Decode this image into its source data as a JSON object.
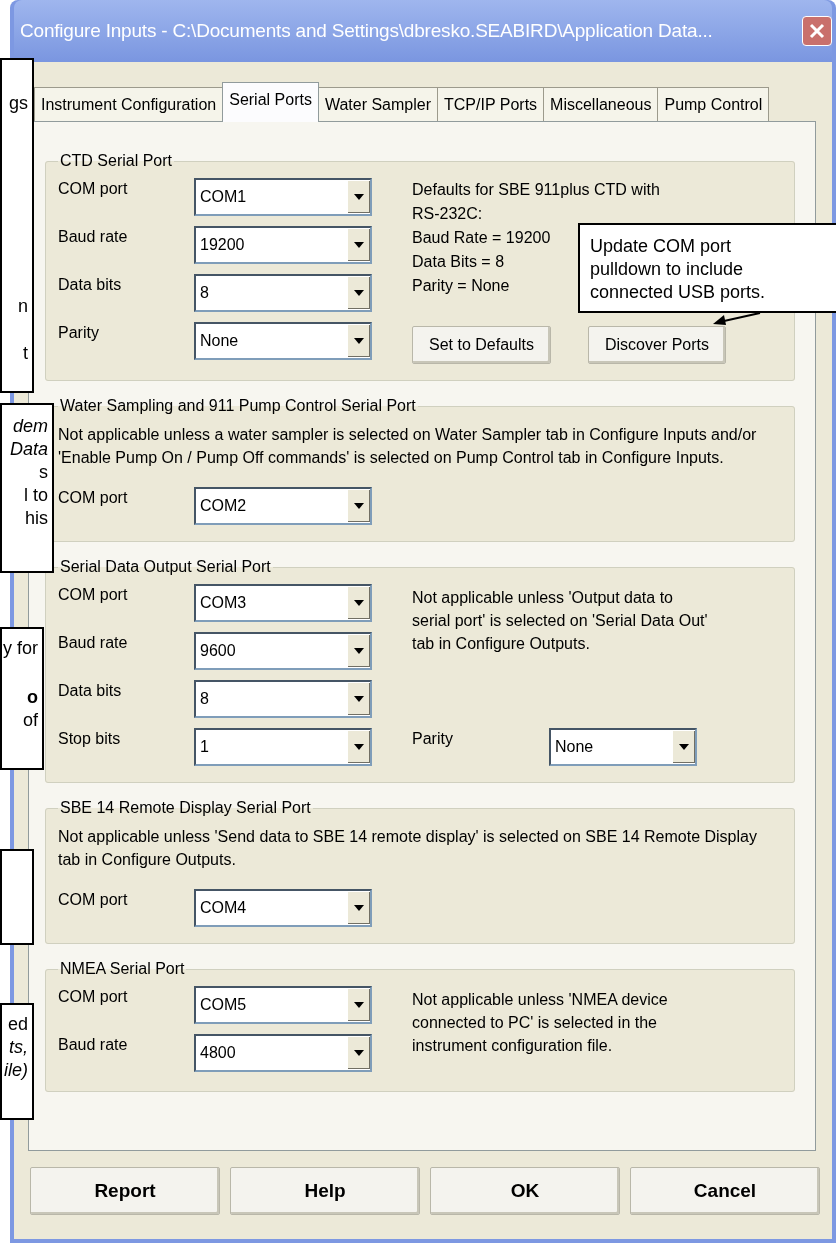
{
  "window": {
    "title": "Configure Inputs - C:\\Documents and Settings\\dbresko.SEABIRD\\Application Data..."
  },
  "tabs": [
    {
      "label": "Instrument Configuration",
      "selected": false
    },
    {
      "label": "Serial Ports",
      "selected": true
    },
    {
      "label": "Water Sampler",
      "selected": false
    },
    {
      "label": "TCP/IP Ports",
      "selected": false
    },
    {
      "label": "Miscellaneous",
      "selected": false
    },
    {
      "label": "Pump Control",
      "selected": false
    }
  ],
  "groups": [
    {
      "kind": "side",
      "title": "CTD Serial Port",
      "fields": [
        {
          "label": "COM port",
          "value": "COM1"
        },
        {
          "label": "Baud rate",
          "value": "19200"
        },
        {
          "label": "Data bits",
          "value": "8"
        },
        {
          "label": "Parity",
          "value": "None"
        }
      ],
      "defaults": [
        "Defaults for SBE 911plus CTD with",
        "RS-232C:",
        "Baud Rate = 19200",
        "Data Bits = 8",
        "Parity = None"
      ],
      "buttons": [
        "Set to Defaults",
        "Discover Ports"
      ]
    },
    {
      "kind": "above",
      "title": "Water Sampling and 911 Pump Control Serial Port",
      "note": "Not applicable unless a water sampler is selected on Water Sampler tab in Configure Inputs and/or 'Enable Pump On / Pump Off commands' is selected on Pump Control tab in Configure Inputs.",
      "fields": [
        {
          "label": "COM port",
          "value": "COM2"
        }
      ]
    },
    {
      "kind": "side",
      "title": "Serial Data Output Serial Port",
      "fields": [
        {
          "label": "COM port",
          "value": "COM3"
        },
        {
          "label": "Baud rate",
          "value": "9600"
        },
        {
          "label": "Data bits",
          "value": "8"
        },
        {
          "label": "Stop bits",
          "value": "1"
        }
      ],
      "note": "Not applicable unless 'Output data to serial port' is selected on 'Serial Data Out' tab in Configure Outputs.",
      "extra_field": {
        "label": "Parity",
        "value": "None"
      }
    },
    {
      "kind": "above",
      "title": "SBE 14 Remote Display Serial Port",
      "note": "Not applicable unless 'Send data to SBE 14 remote display' is selected on SBE 14 Remote Display tab in Configure Outputs.",
      "fields": [
        {
          "label": "COM port",
          "value": "COM4"
        }
      ]
    },
    {
      "kind": "side",
      "title": "NMEA Serial Port",
      "fields": [
        {
          "label": "COM port",
          "value": "COM5"
        },
        {
          "label": "Baud rate",
          "value": "4800"
        }
      ],
      "note": "Not applicable unless 'NMEA device connected to PC' is selected in the instrument configuration file."
    }
  ],
  "buttons": [
    "Report",
    "Help",
    "OK",
    "Cancel"
  ],
  "callouts": [
    {
      "kind": "edge",
      "lines": [
        {
          "text": "gs",
          "kind": "plain"
        },
        {
          "text": "n",
          "kind": "plain"
        },
        {
          "text": "t",
          "kind": "plain"
        }
      ]
    },
    {
      "kind": "edge",
      "lines": [
        {
          "text": "dem",
          "kind": "italic"
        },
        {
          "text": "Data",
          "kind": "italic"
        },
        {
          "text": "s",
          "kind": "plain"
        },
        {
          "text": "l to",
          "kind": "plain"
        },
        {
          "text": "his",
          "kind": "plain"
        }
      ]
    },
    {
      "kind": "edge",
      "lines": [
        {
          "text": "y for",
          "kind": "plain"
        },
        {
          "text": "o",
          "kind": "bold"
        },
        {
          "text": "of",
          "kind": "plain"
        }
      ]
    },
    {
      "kind": "edge"
    },
    {
      "kind": "edge",
      "lines": [
        {
          "text": "ed",
          "kind": "plain"
        },
        {
          "text": "ts,",
          "kind": "italic"
        },
        {
          "text": "ile)",
          "kind": "italic"
        }
      ]
    },
    {
      "kind": "pointer",
      "lines": [
        {
          "text": "Update COM port",
          "kind": "plain"
        },
        {
          "text": "pulldown to include",
          "kind": "plain"
        },
        {
          "text": "connected USB ports.",
          "kind": "plain"
        }
      ]
    }
  ]
}
